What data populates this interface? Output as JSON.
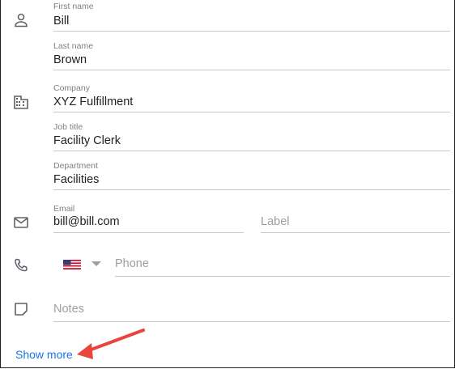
{
  "contact": {
    "first_name": {
      "label": "First name",
      "value": "Bill"
    },
    "last_name": {
      "label": "Last name",
      "value": "Brown"
    },
    "company": {
      "label": "Company",
      "value": "XYZ Fulfillment"
    },
    "job_title": {
      "label": "Job title",
      "value": "Facility Clerk"
    },
    "department": {
      "label": "Department",
      "value": "Facilities"
    },
    "email": {
      "label": "Email",
      "value": "bill@bill.com",
      "label_placeholder": "Label"
    },
    "phone": {
      "placeholder": "Phone",
      "country": "US"
    },
    "notes": {
      "placeholder": "Notes"
    }
  },
  "show_more_label": "Show more",
  "icons": {
    "person": "person-icon",
    "company": "building-icon",
    "email": "email-icon",
    "phone": "phone-icon",
    "notes": "notes-icon"
  },
  "colors": {
    "link": "#1a73e8",
    "arrow": "#e8453c",
    "icon": "#5f6368",
    "divider": "#c9c9c9"
  }
}
